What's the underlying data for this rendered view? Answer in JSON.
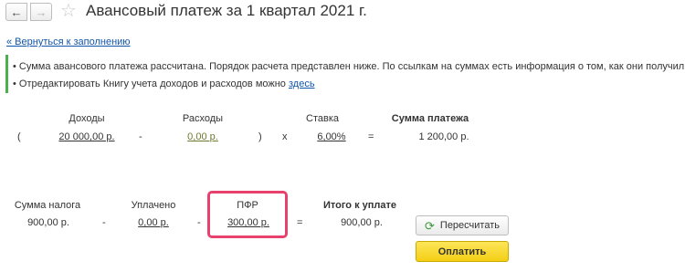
{
  "header": {
    "back_icon": "←",
    "forward_icon": "→",
    "star_icon": "☆",
    "title": "Авансовый платеж за 1 квартал 2021 г."
  },
  "back_link": "« Вернуться к заполнению",
  "info": {
    "bullet": "•",
    "line1": "Сумма авансового платежа рассчитана. Порядок расчета представлен ниже. По ссылкам на суммах есть информация о том, как они получились.",
    "line2_text": "Отредактировать Книгу учета доходов и расходов можно",
    "line2_link": "здесь"
  },
  "calc": {
    "income_label": "Доходы",
    "expenses_label": "Расходы",
    "rate_label": "Ставка",
    "payment_label": "Сумма платежа",
    "open_paren": "(",
    "income_value": "20 000,00 р.",
    "minus": "-",
    "expenses_value": "0,00 р.",
    "close_paren": ")",
    "times": "x",
    "rate_value": "6,00%",
    "equals": "=",
    "payment_value": "1 200,00 р."
  },
  "totals": {
    "tax_label": "Сумма налога",
    "paid_label": "Уплачено",
    "pfr_label": "ПФР",
    "total_label": "Итого к уплате",
    "tax_value": "900,00 р.",
    "minus1": "-",
    "paid_value": "0,00 р.",
    "minus2": "-",
    "pfr_value": "300,00 р.",
    "equals": "=",
    "total_value": "900,00 р."
  },
  "buttons": {
    "recalc_icon": "⟳",
    "recalc_label": "Пересчитать",
    "pay_label": "Оплатить"
  },
  "colors": {
    "link": "#1155aa",
    "info_bar": "#4caf50",
    "highlight_box": "#e8416e",
    "pay_button": "#f4cf14"
  }
}
